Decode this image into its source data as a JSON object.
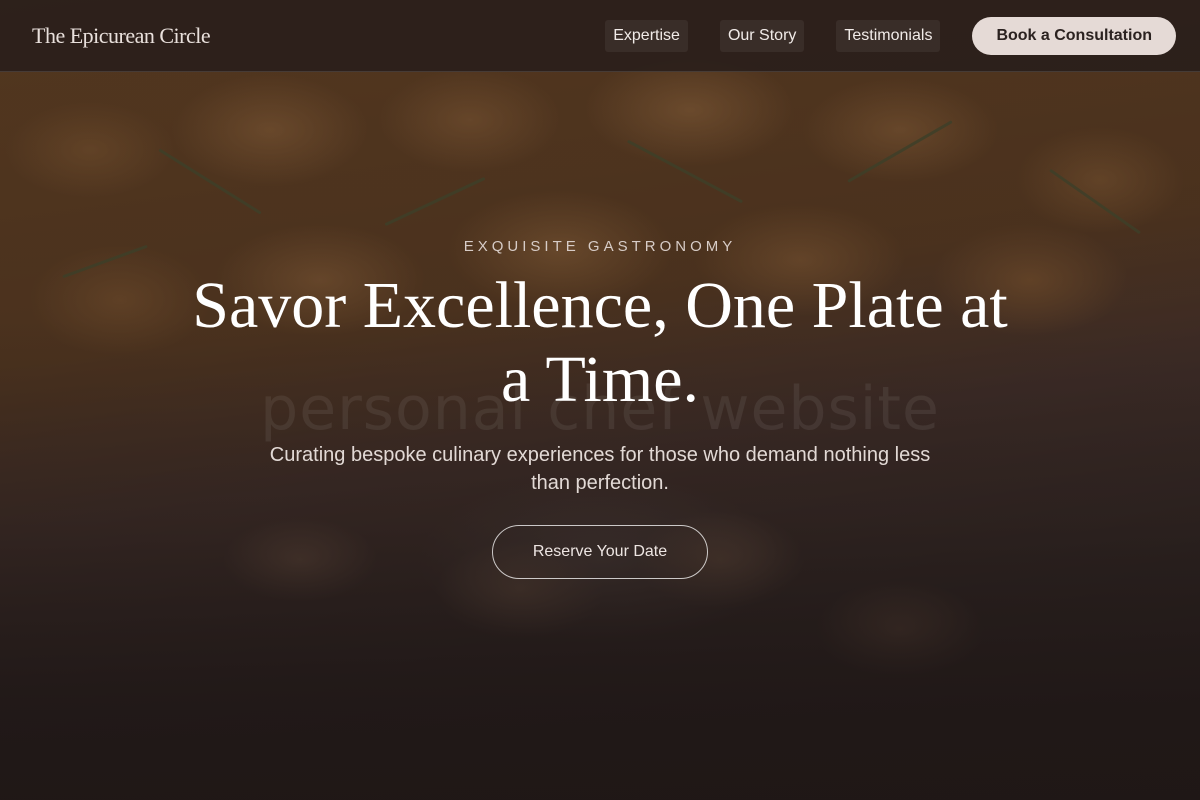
{
  "header": {
    "brand": "The Epicurean Circle",
    "nav": [
      {
        "label": "Expertise"
      },
      {
        "label": "Our Story"
      },
      {
        "label": "Testimonials"
      }
    ],
    "cta_label": "Book a Consultation"
  },
  "hero": {
    "eyebrow": "EXQUISITE GASTRONOMY",
    "headline": "Savor Excellence, One Plate at a Time.",
    "subhead": "Curating bespoke culinary experiences for those who demand nothing less than perfection.",
    "cta_label": "Reserve Your Date",
    "watermark": "personal chef website"
  },
  "colors": {
    "background": "#1f1716",
    "header_bg": "#241c1a",
    "cta_bg": "#e5dad6",
    "cta_text": "#2b2220",
    "headline_text": "#ffffff"
  }
}
